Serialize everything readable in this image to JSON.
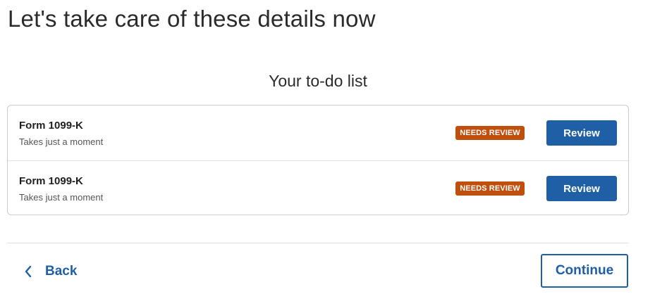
{
  "header": {
    "title": "Let's take care of these details now"
  },
  "todo": {
    "title": "Your to-do list",
    "items": [
      {
        "title": "Form 1099-K",
        "subtitle": "Takes just a moment",
        "status": "NEEDS REVIEW",
        "action_label": "Review"
      },
      {
        "title": "Form 1099-K",
        "subtitle": "Takes just a moment",
        "status": "NEEDS REVIEW",
        "action_label": "Review"
      }
    ]
  },
  "footer": {
    "back_label": "Back",
    "continue_label": "Continue"
  },
  "colors": {
    "accent": "#1f5fa6",
    "badge": "#c04f0d"
  },
  "icons": {
    "back": "chevron-left-icon"
  }
}
